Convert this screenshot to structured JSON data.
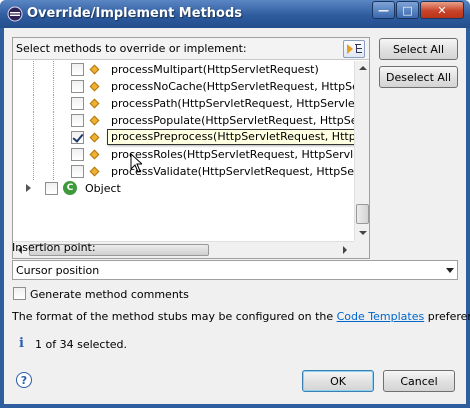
{
  "window": {
    "title": "Override/Implement Methods",
    "controls": {
      "minimize": "—",
      "maximize": "□",
      "close": "✕"
    }
  },
  "tree": {
    "header_label": "Select methods to override or implement:",
    "rows": [
      {
        "text": "processMultipart(HttpServletRequest)",
        "checked": false
      },
      {
        "text": "processNoCache(HttpServletRequest, HttpServletR",
        "checked": false
      },
      {
        "text": "processPath(HttpServletRequest, HttpServletRespo",
        "checked": false
      },
      {
        "text": "processPopulate(HttpServletRequest, HttpServletRe",
        "checked": false
      },
      {
        "text": "processPreprocess(HttpServletRequest, HttpServletResponse)",
        "checked": true
      },
      {
        "text": "processRoles(HttpServletRequest, HttpServletResp",
        "checked": false
      },
      {
        "text": "processValidate(HttpServletRequest, HttpServletRe",
        "checked": false
      }
    ],
    "object_row": {
      "icon_letter": "C",
      "text": "Object"
    }
  },
  "buttons": {
    "select_all": "Select All",
    "deselect_all": "Deselect All",
    "ok": "OK",
    "cancel": "Cancel"
  },
  "insertion": {
    "label": "Insertion point:",
    "value": "Cursor position"
  },
  "generate_comments": {
    "label": "Generate method comments",
    "checked": false
  },
  "info": {
    "text_before": "The format of the method stubs may be configured on the ",
    "link": "Code Templates",
    "text_after": " preference page.",
    "status": "1 of 34 selected.",
    "info_glyph": "i",
    "help_glyph": "?"
  },
  "colors": {
    "title_bar": "#2e5c9e",
    "close_button": "#c7442a",
    "link": "#0066cc",
    "method_icon": "#f0b030",
    "class_icon": "#3f9a3b"
  }
}
